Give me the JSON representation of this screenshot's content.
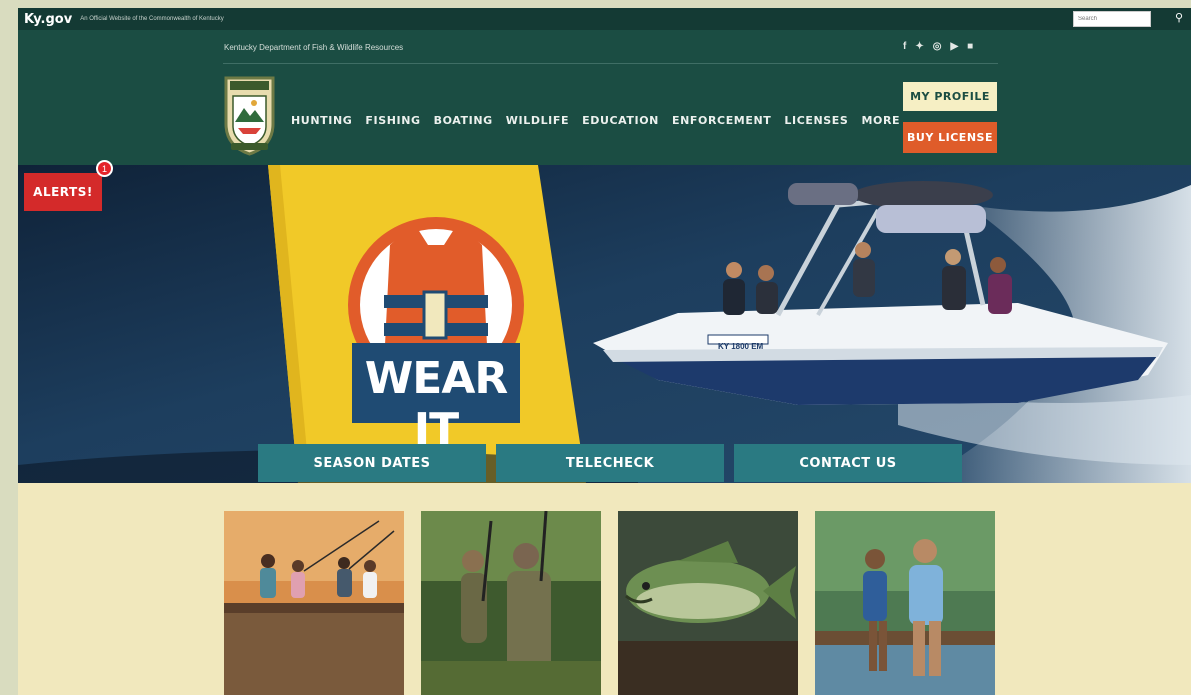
{
  "kygov": {
    "logo": "Ky.gov",
    "tagline": "An Official Website of the Commonwealth of Kentucky",
    "search_placeholder": "Search"
  },
  "header": {
    "department": "Kentucky Department of Fish & Wildlife Resources",
    "social_icons": [
      "facebook-icon",
      "twitter-icon",
      "instagram-icon",
      "youtube-icon",
      "flickr-icon"
    ],
    "nav": [
      "HUNTING",
      "FISHING",
      "BOATING",
      "WILDLIFE",
      "EDUCATION",
      "ENFORCEMENT",
      "LICENSES",
      "MORE"
    ],
    "my_profile": "MY PROFILE",
    "buy_license": "BUY LICENSE"
  },
  "alerts": {
    "label": "ALERTS!",
    "count": "1"
  },
  "hero": {
    "campaign": "WEAR IT",
    "boat_registration": "KY 1800 EM"
  },
  "quick_links": [
    "SEASON DATES",
    "TELECHECK",
    "CONTACT US"
  ],
  "cards": [
    "family-fishing-photo",
    "hunters-photo",
    "bass-fish-photo",
    "dock-fishing-photo"
  ],
  "colors": {
    "header": "#1b4d43",
    "accent_orange": "#df5c2a",
    "quick_link": "#2a7a82",
    "alert": "#d42a2a",
    "cream": "#f1e8bd"
  }
}
